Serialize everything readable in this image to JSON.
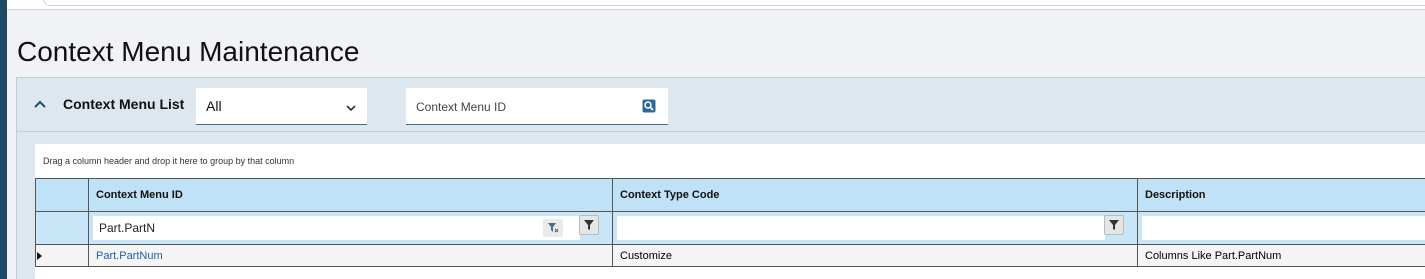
{
  "page": {
    "title": "Context Menu Maintenance"
  },
  "panel": {
    "title": "Context Menu List",
    "filter_select": {
      "value": "All"
    },
    "search": {
      "placeholder": "Context Menu ID"
    }
  },
  "grid": {
    "group_hint": "Drag a column header and drop it here to group by that column",
    "columns": [
      "Context Menu ID",
      "Context Type Code",
      "Description"
    ],
    "filters": {
      "context_menu_id": "Part.PartN",
      "context_type_code": "",
      "description": ""
    },
    "rows": [
      {
        "context_menu_id": "Part.PartNum",
        "context_type_code": "Customize",
        "description": "Columns Like Part.PartNum"
      }
    ]
  },
  "colors": {
    "accent": "#1e4a66",
    "header_bg": "#bfe2f7",
    "link": "#1f5fa8"
  },
  "icons": [
    "chevron-up-icon",
    "chevron-down-icon",
    "search-icon",
    "filter-icon",
    "clear-filter-icon"
  ]
}
